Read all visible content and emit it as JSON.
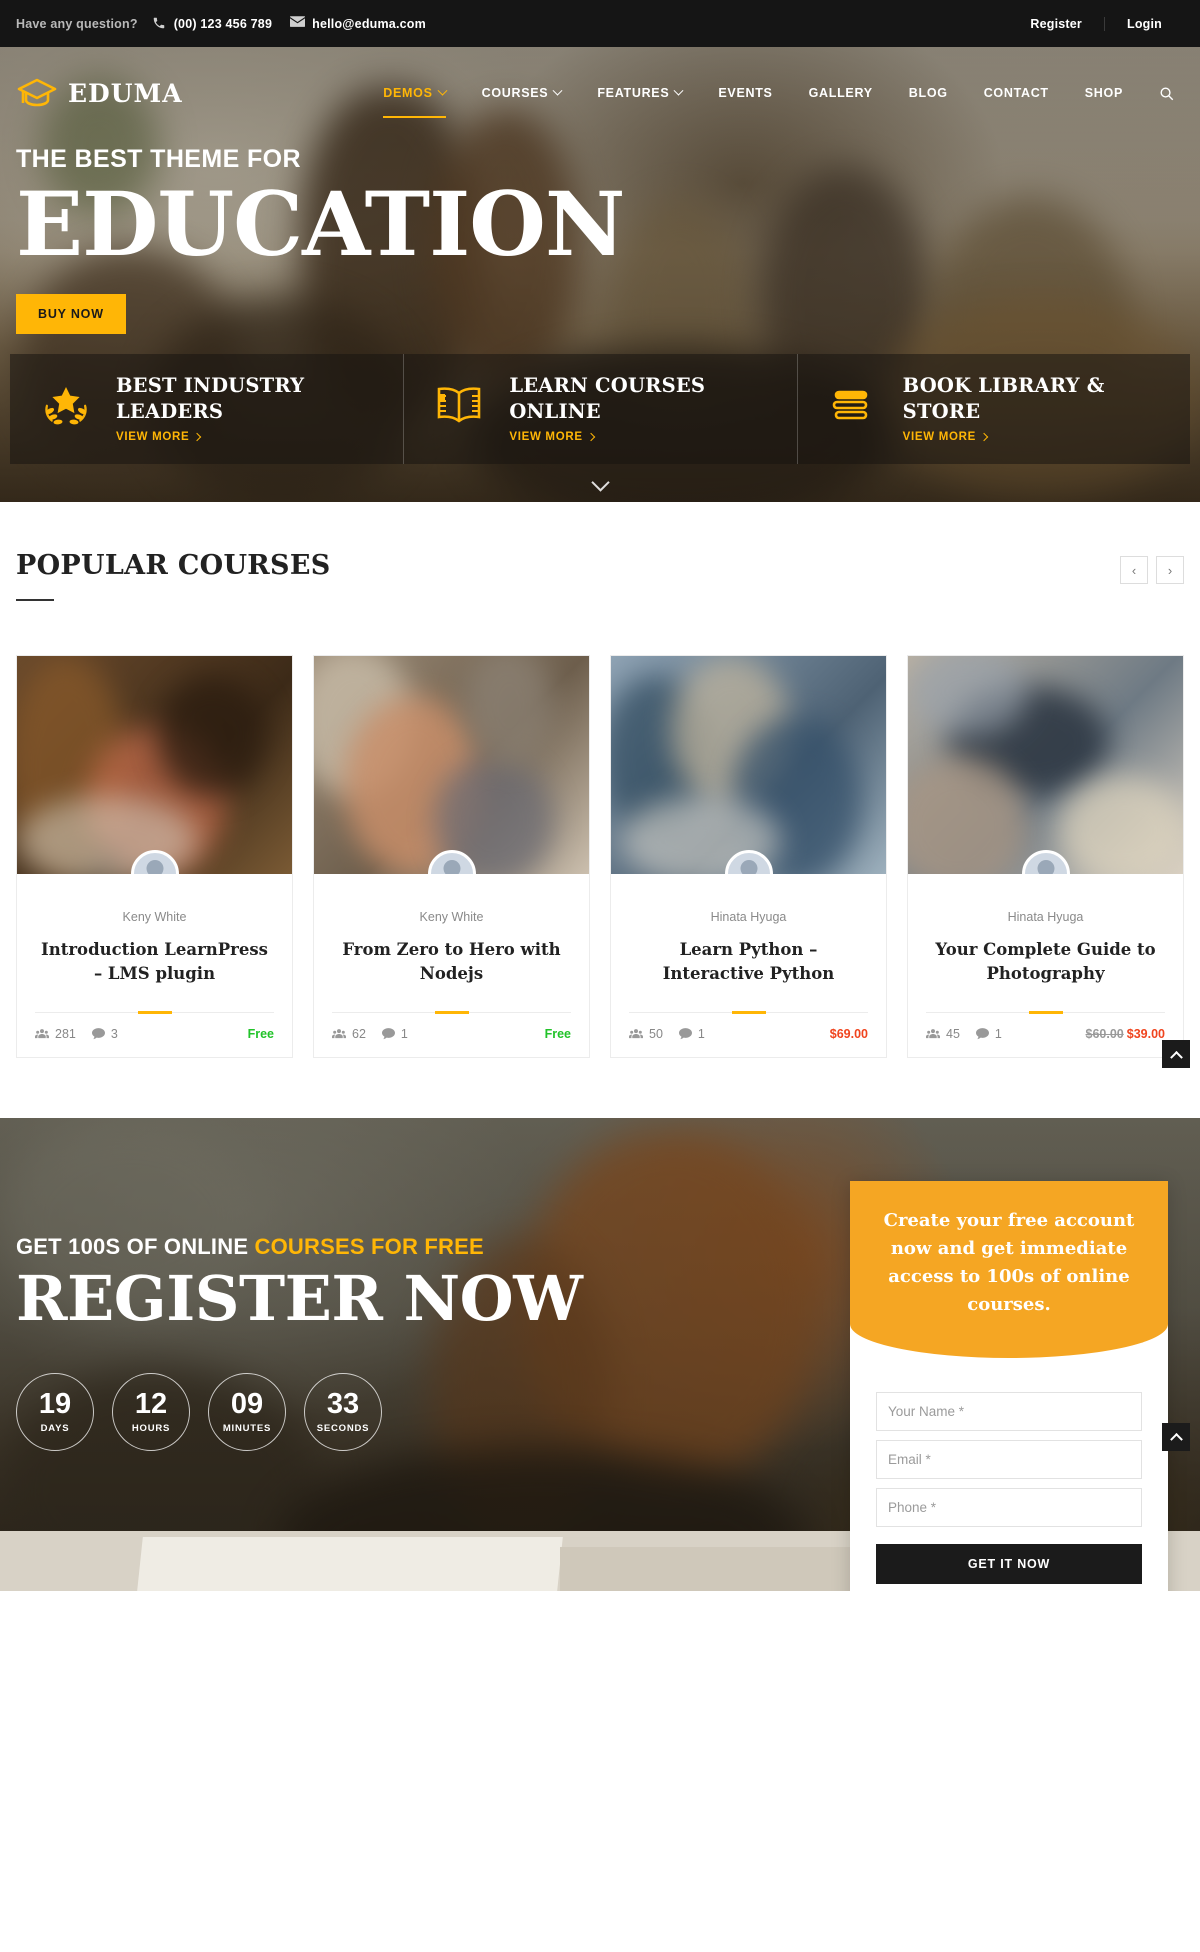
{
  "topbar": {
    "question": "Have any question?",
    "phone": "(00) 123 456 789",
    "email": "hello@eduma.com",
    "register": "Register",
    "login": "Login"
  },
  "nav": {
    "brand": "EDUMA",
    "items": [
      {
        "label": "DEMOS",
        "has_caret": true,
        "active": true
      },
      {
        "label": "COURSES",
        "has_caret": true,
        "active": false
      },
      {
        "label": "FEATURES",
        "has_caret": true,
        "active": false
      },
      {
        "label": "EVENTS",
        "has_caret": false,
        "active": false
      },
      {
        "label": "GALLERY",
        "has_caret": false,
        "active": false
      },
      {
        "label": "BLOG",
        "has_caret": false,
        "active": false
      },
      {
        "label": "CONTACT",
        "has_caret": false,
        "active": false
      },
      {
        "label": "SHOP",
        "has_caret": false,
        "active": false
      }
    ]
  },
  "hero": {
    "subtitle": "THE BEST THEME FOR",
    "title": "EDUCATION",
    "cta": "BUY NOW",
    "features": [
      {
        "icon": "laurel-star-icon",
        "title": "BEST INDUSTRY LEADERS",
        "link": "VIEW MORE"
      },
      {
        "icon": "open-book-icon",
        "title": "LEARN COURSES ONLINE",
        "link": "VIEW MORE"
      },
      {
        "icon": "book-stack-icon",
        "title": "BOOK LIBRARY & STORE",
        "link": "VIEW MORE"
      }
    ]
  },
  "courses": {
    "section_title": "POPULAR COURSES",
    "prev_label": "‹",
    "next_label": "›",
    "items": [
      {
        "author": "Keny White",
        "title": "Introduction LearnPress – LMS plugin",
        "students": "281",
        "comments": "3",
        "price": "Free",
        "price_old": "",
        "is_free": true
      },
      {
        "author": "Keny White",
        "title": "From Zero to Hero with Nodejs",
        "students": "62",
        "comments": "1",
        "price": "Free",
        "price_old": "",
        "is_free": true
      },
      {
        "author": "Hinata Hyuga",
        "title": "Learn Python – Interactive Python",
        "students": "50",
        "comments": "1",
        "price": "$69.00",
        "price_old": "",
        "is_free": false
      },
      {
        "author": "Hinata Hyuga",
        "title": "Your Complete Guide to Photography",
        "students": "45",
        "comments": "1",
        "price": "$39.00",
        "price_old": "$60.00",
        "is_free": false
      }
    ]
  },
  "register": {
    "kicker_plain": "GET 100S OF ONLINE ",
    "kicker_highlight": "COURSES FOR FREE",
    "title": "REGISTER NOW",
    "countdown": [
      {
        "value": "19",
        "label": "DAYS"
      },
      {
        "value": "12",
        "label": "HOURS"
      },
      {
        "value": "09",
        "label": "MINUTES"
      },
      {
        "value": "33",
        "label": "SECONDS"
      }
    ],
    "card": {
      "heading": "Create your free account now and get immediate access to 100s of online courses.",
      "name_placeholder": "Your Name *",
      "email_placeholder": "Email *",
      "phone_placeholder": "Phone *",
      "submit": "GET IT NOW"
    }
  },
  "colors": {
    "accent": "#ffb606",
    "accent_card": "#f5a623",
    "free_green": "#22c32a",
    "price_red": "#f0441e",
    "dark": "#151515"
  }
}
